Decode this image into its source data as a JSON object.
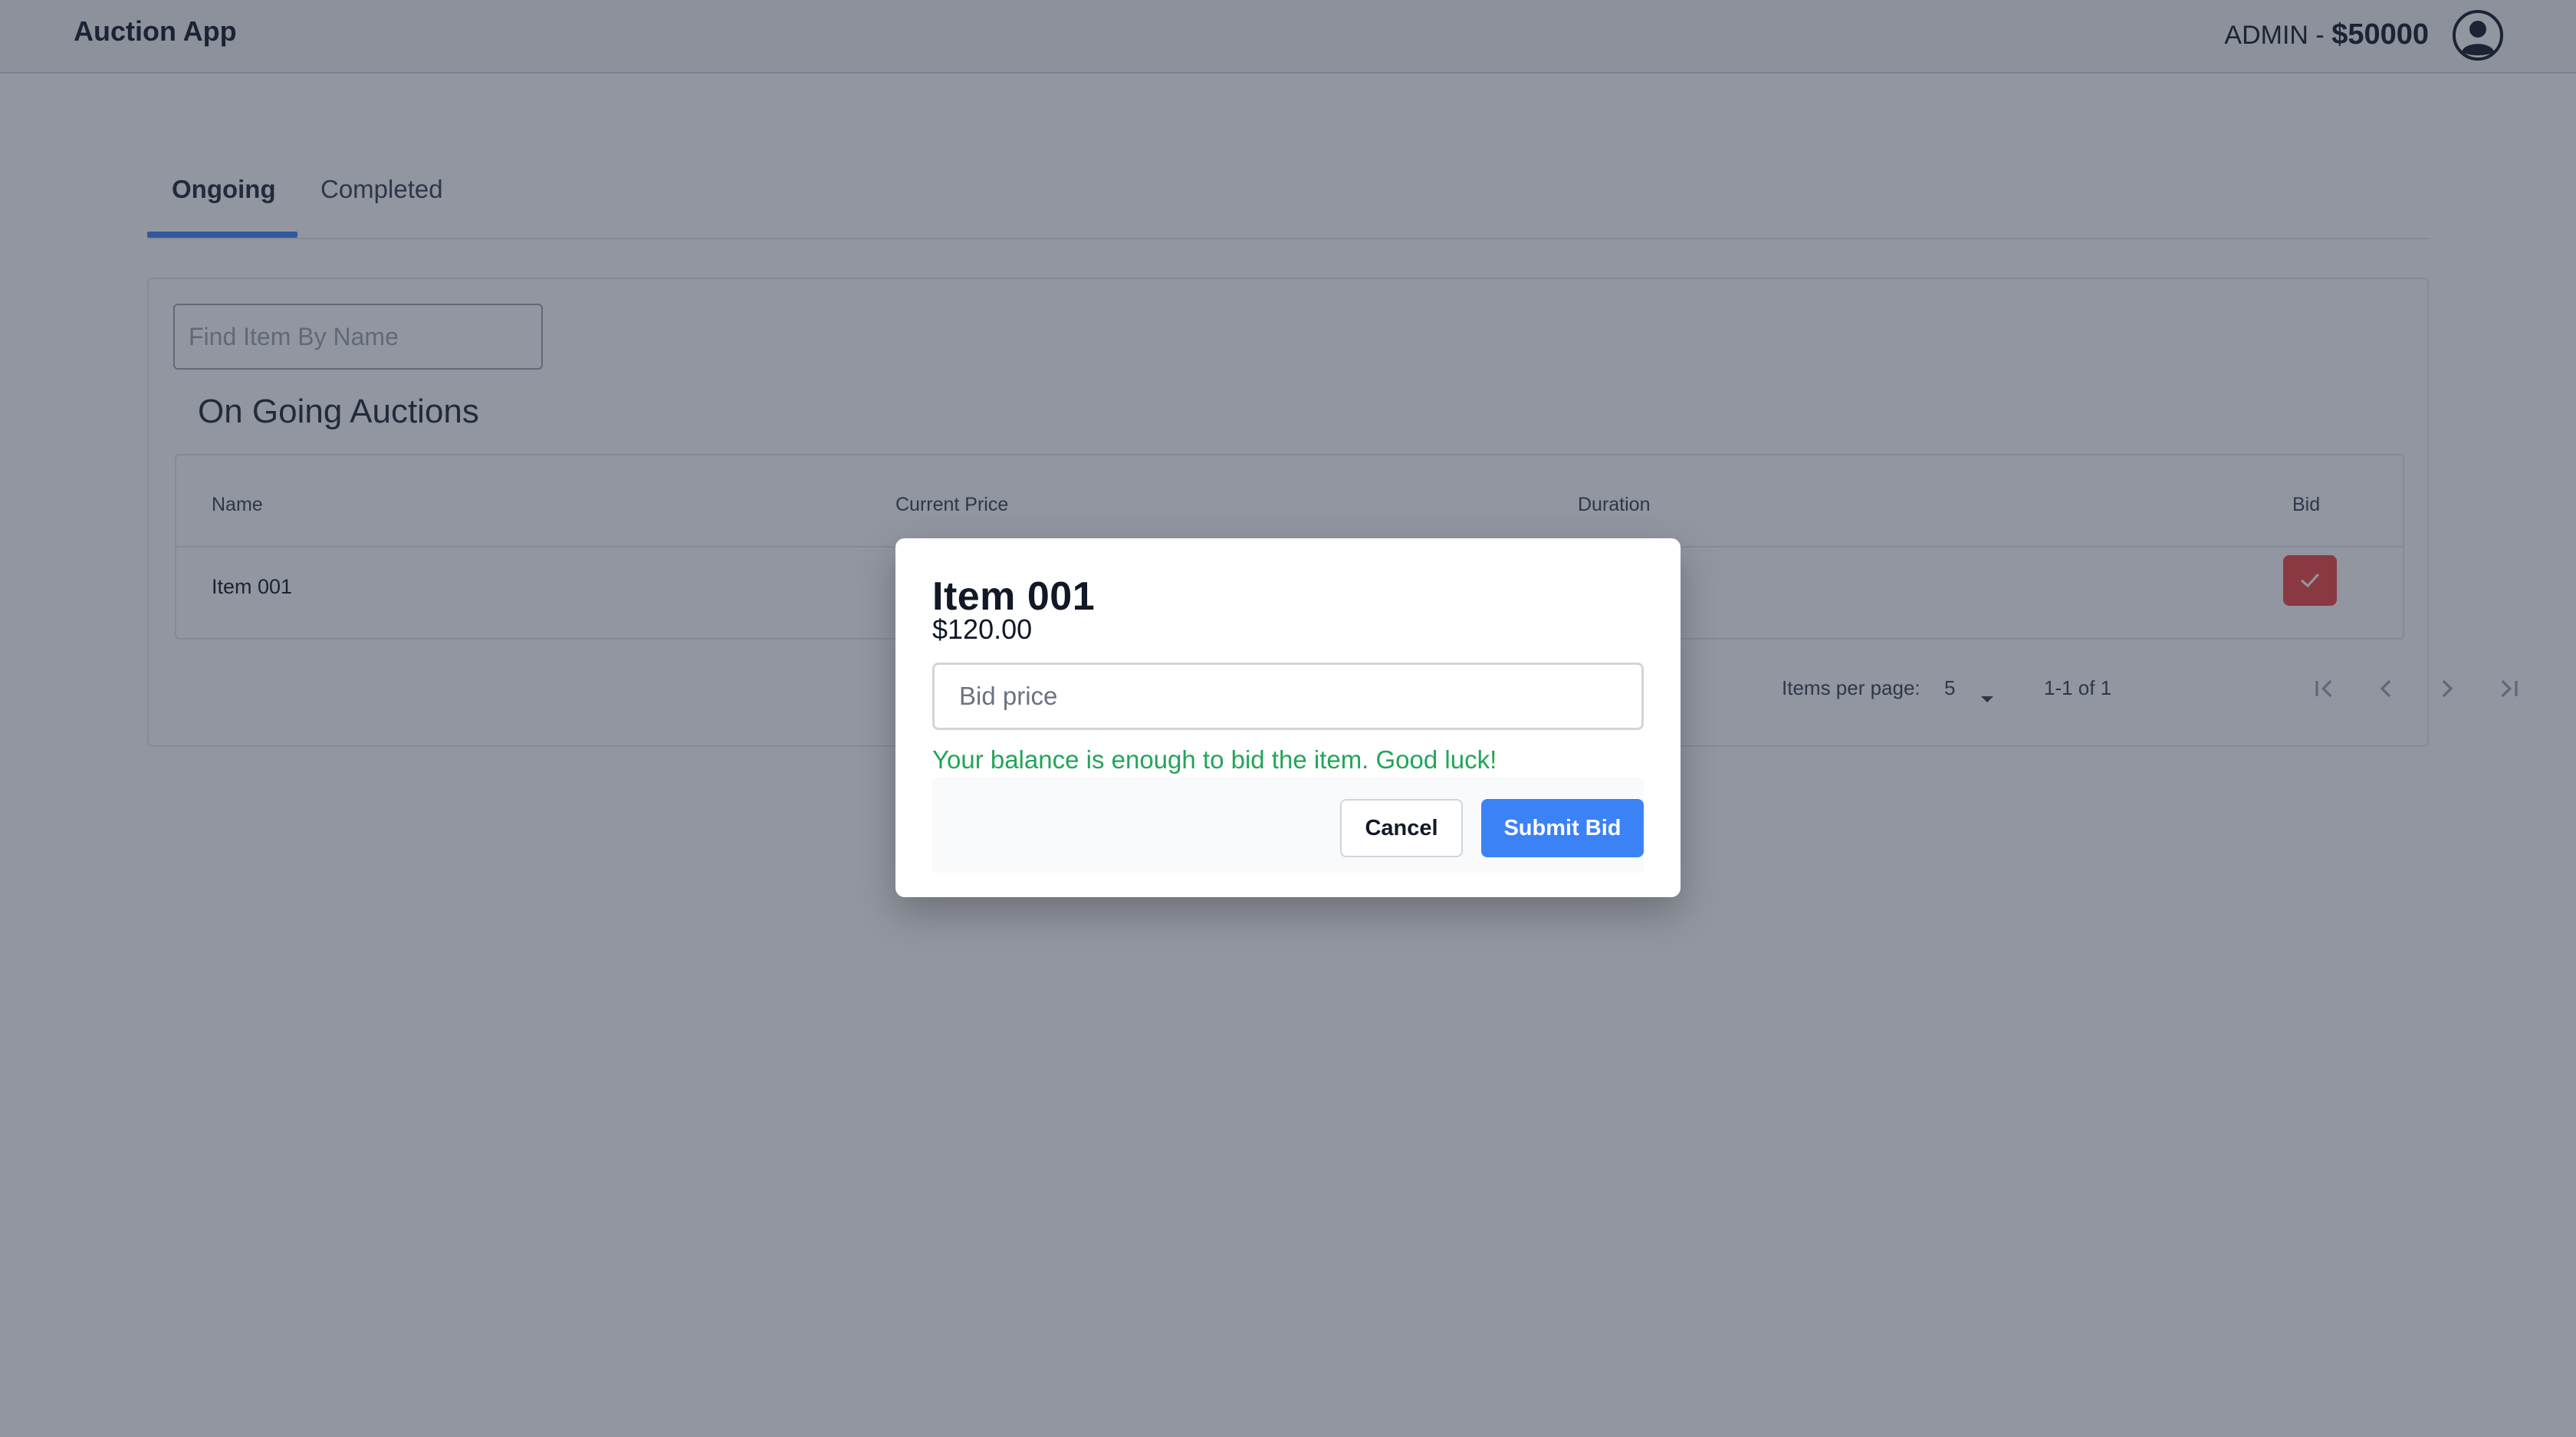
{
  "header": {
    "app_title": "Auction App",
    "user_label": "ADMIN - ",
    "balance": "$50000",
    "avatar_icon": "user-circle-icon"
  },
  "tabs": [
    {
      "label": "Ongoing",
      "active": true
    },
    {
      "label": "Completed",
      "active": false
    }
  ],
  "search": {
    "placeholder": "Find Item By Name",
    "value": ""
  },
  "section_title": "On Going Auctions",
  "table": {
    "columns": [
      "Name",
      "Current Price",
      "Duration",
      "Bid"
    ],
    "rows": [
      {
        "name": "Item 001",
        "current_price": "",
        "duration": "",
        "bid_icon": "check-icon"
      }
    ]
  },
  "paginator": {
    "items_per_page_label": "Items per page:",
    "items_per_page_value": "5",
    "range_label": "1-1 of 1",
    "icons": [
      "first-page-icon",
      "prev-page-icon",
      "next-page-icon",
      "last-page-icon"
    ]
  },
  "modal": {
    "title": "Item 001",
    "price": "$120.00",
    "bid_placeholder": "Bid price",
    "bid_value": "",
    "message": "Your balance is enough to bid the item. Good luck!",
    "cancel_label": "Cancel",
    "submit_label": "Submit Bid"
  },
  "colors": {
    "accent": "#3b82f6",
    "success": "#22a55a",
    "bid_button": "#ef4444",
    "overlay": "rgba(37,45,66,0.5)"
  }
}
